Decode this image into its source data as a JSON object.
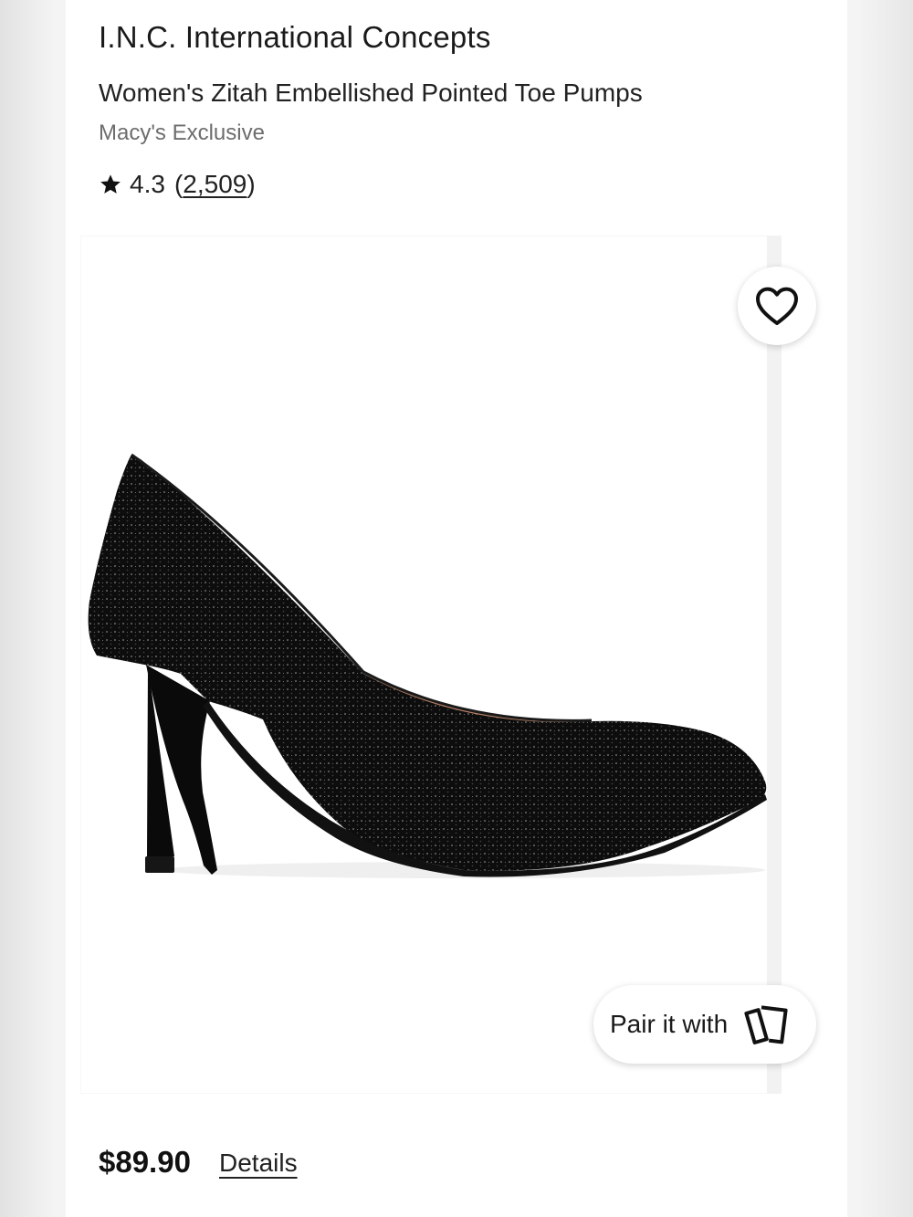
{
  "brand": "I.N.C. International Concepts",
  "product": {
    "name": "Women's Zitah Embellished Pointed Toe Pumps",
    "tag": "Macy's Exclusive"
  },
  "rating": {
    "value": "4.3",
    "count_open": "(",
    "count": "2,509",
    "count_close": ")",
    "icon": "star-icon"
  },
  "image": {
    "alt": "black embellished pointed toe pump",
    "favorite_icon": "heart-icon"
  },
  "pair": {
    "label": "Pair it with",
    "icon": "cards-icon"
  },
  "price": "$89.90",
  "details_label": "Details"
}
